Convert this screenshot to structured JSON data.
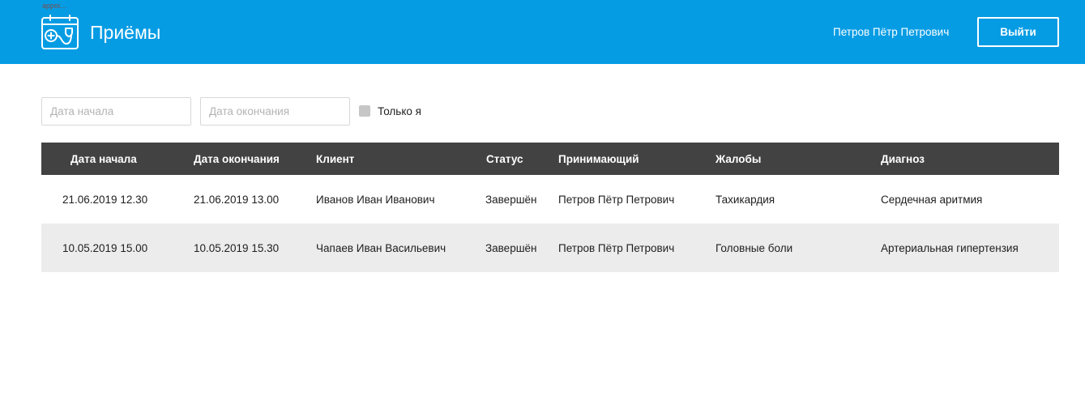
{
  "header": {
    "caption": "appoi...",
    "title": "Приёмы",
    "user_name": "Петров Пётр Петрович",
    "logout_label": "Выйти",
    "logo_icon": "calendar-stethoscope-icon",
    "bg_color": "#069ce4"
  },
  "filters": {
    "start_placeholder": "Дата начала",
    "end_placeholder": "Дата окончания",
    "only_me_label": "Только я",
    "only_me_checked": false
  },
  "table": {
    "columns": [
      "Дата начала",
      "Дата окончания",
      "Клиент",
      "Статус",
      "Принимающий",
      "Жалобы",
      "Диагноз"
    ],
    "rows": [
      [
        "21.06.2019 12.30",
        "21.06.2019 13.00",
        "Иванов Иван Иванович",
        "Завершён",
        "Петров Пётр Петрович",
        "Тахикардия",
        "Сердечная аритмия"
      ],
      [
        "10.05.2019 15.00",
        "10.05.2019 15.30",
        "Чапаев Иван Васильевич",
        "Завершён",
        "Петров Пётр Петрович",
        "Головные боли",
        "Артериальная гипертензия"
      ]
    ],
    "header_color": "#424242",
    "alt_row_color": "#ececec"
  }
}
